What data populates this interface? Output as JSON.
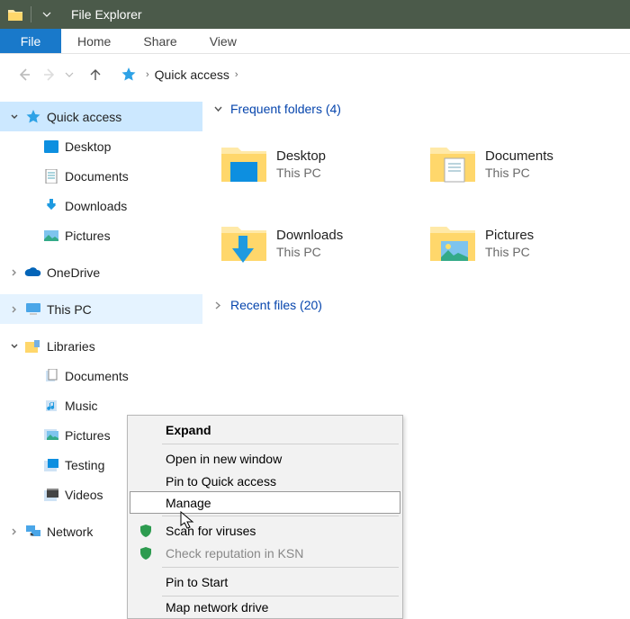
{
  "titlebar": {
    "title": "File Explorer"
  },
  "ribbon": {
    "file": "File",
    "tabs": [
      "Home",
      "Share",
      "View"
    ]
  },
  "breadcrumb": {
    "text": "Quick access"
  },
  "sidebar": {
    "quick_access": {
      "label": "Quick access",
      "children": [
        "Desktop",
        "Documents",
        "Downloads",
        "Pictures"
      ]
    },
    "onedrive": "OneDrive",
    "this_pc": "This PC",
    "libraries": {
      "label": "Libraries",
      "children": [
        "Documents",
        "Music",
        "Pictures",
        "Testing",
        "Videos"
      ]
    },
    "network": "Network"
  },
  "content": {
    "frequent_header": "Frequent folders (4)",
    "recent_header": "Recent files (20)",
    "folders": [
      {
        "name": "Desktop",
        "loc": "This PC"
      },
      {
        "name": "Documents",
        "loc": "This PC"
      },
      {
        "name": "Downloads",
        "loc": "This PC"
      },
      {
        "name": "Pictures",
        "loc": "This PC"
      }
    ]
  },
  "context_menu": {
    "expand": "Expand",
    "open_new": "Open in new window",
    "pin_qa": "Pin to Quick access",
    "manage": "Manage",
    "scan": "Scan for viruses",
    "ksn": "Check reputation in KSN",
    "pin_start": "Pin to Start",
    "map_drive": "Map network drive"
  }
}
